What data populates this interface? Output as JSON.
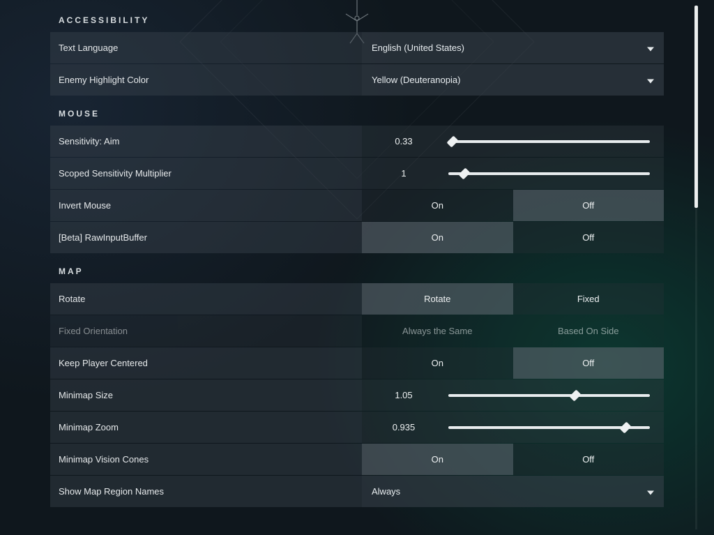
{
  "sections": {
    "accessibility": {
      "title": "ACCESSIBILITY",
      "text_language": {
        "label": "Text Language",
        "value": "English (United States)"
      },
      "enemy_highlight": {
        "label": "Enemy Highlight Color",
        "value": "Yellow (Deuteranopia)"
      }
    },
    "mouse": {
      "title": "MOUSE",
      "sensitivity": {
        "label": "Sensitivity: Aim",
        "value": "0.33",
        "pos": 0.02
      },
      "scoped_mult": {
        "label": "Scoped Sensitivity Multiplier",
        "value": "1",
        "pos": 0.08
      },
      "invert": {
        "label": "Invert Mouse",
        "on": "On",
        "off": "Off",
        "selected": "off"
      },
      "raw_input": {
        "label": "[Beta] RawInputBuffer",
        "on": "On",
        "off": "Off",
        "selected": "on"
      }
    },
    "map": {
      "title": "MAP",
      "rotate": {
        "label": "Rotate",
        "a": "Rotate",
        "b": "Fixed",
        "selected": "a"
      },
      "fixed_orient": {
        "label": "Fixed Orientation",
        "a": "Always the Same",
        "b": "Based On Side",
        "selected": "none",
        "disabled": true
      },
      "keep_centered": {
        "label": "Keep Player Centered",
        "on": "On",
        "off": "Off",
        "selected": "off"
      },
      "minimap_size": {
        "label": "Minimap Size",
        "value": "1.05",
        "pos": 0.63
      },
      "minimap_zoom": {
        "label": "Minimap Zoom",
        "value": "0.935",
        "pos": 0.88
      },
      "vision_cones": {
        "label": "Minimap Vision Cones",
        "on": "On",
        "off": "Off",
        "selected": "on"
      },
      "region_names": {
        "label": "Show Map Region Names",
        "value": "Always"
      }
    }
  }
}
